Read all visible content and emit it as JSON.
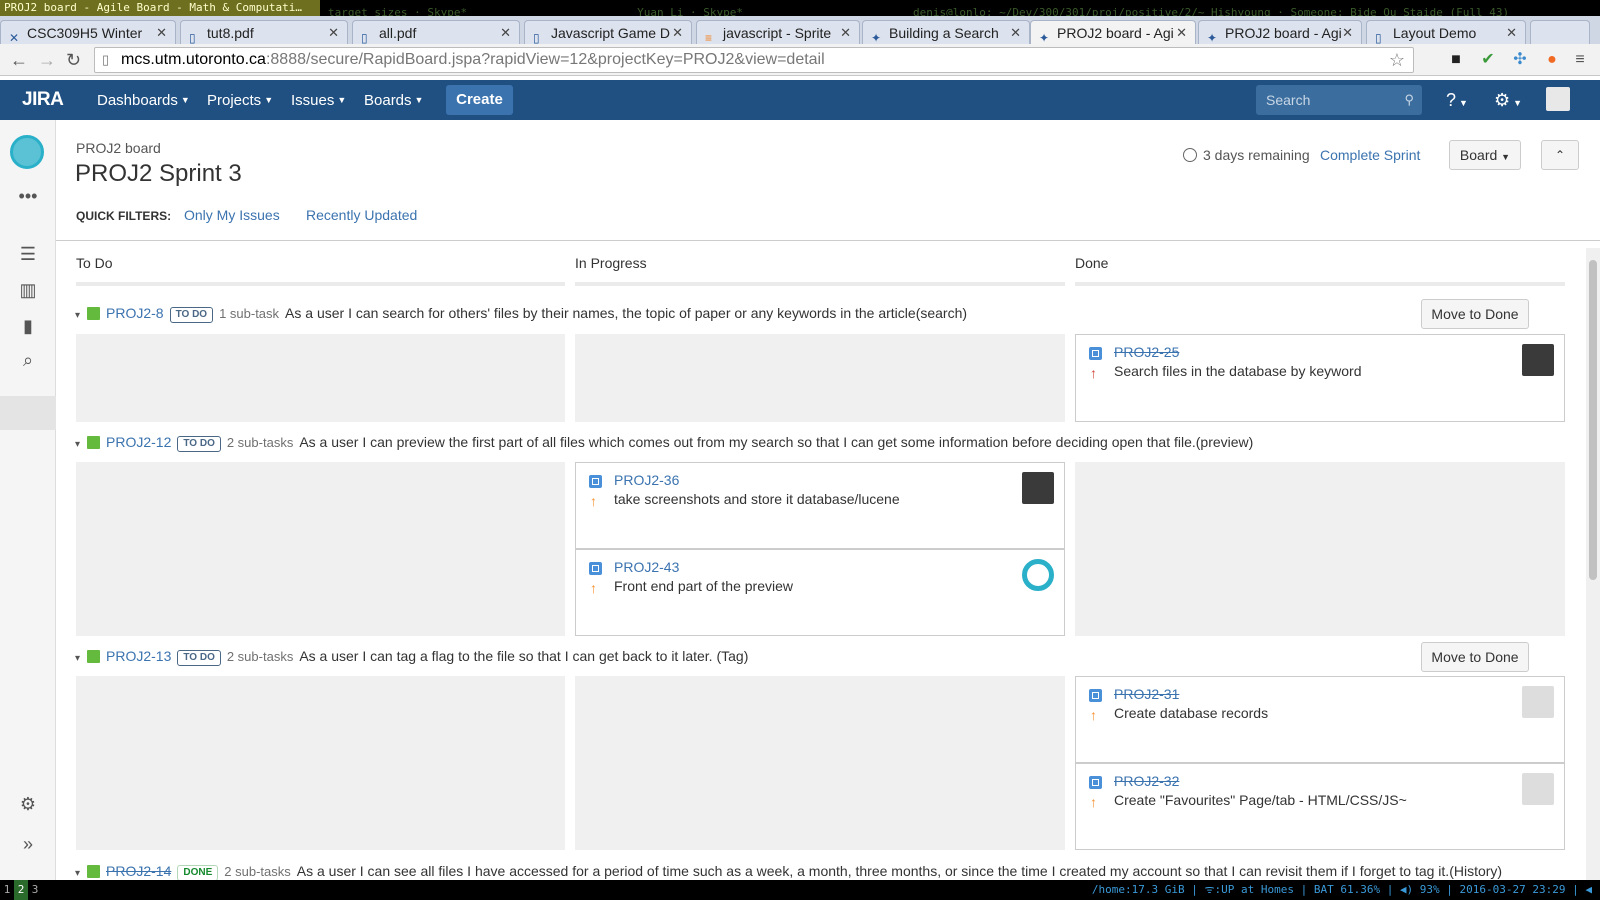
{
  "wm": {
    "active_title": "PROJ2 board - Agile Board - Math & Computati…",
    "dim_1": "target sizes  · Skype*",
    "dim_2": "Yuan Li · Skype*",
    "dim_3": "denis@lonlo: ~/Dev/300/301/proj/positive/2/~ Hishyoung · Someone: Bide Ou Staide (Full 43)"
  },
  "browser_tabs": [
    {
      "label": "CSC309H5 Winter",
      "icon": "jira-icon"
    },
    {
      "label": "tut8.pdf",
      "icon": "document-icon"
    },
    {
      "label": "all.pdf",
      "icon": "document-icon"
    },
    {
      "label": "Javascript Game D",
      "icon": "document-icon"
    },
    {
      "label": "javascript - Sprite",
      "icon": "stackoverflow-icon"
    },
    {
      "label": "Building a Search",
      "icon": "jira-icon"
    },
    {
      "label": "PROJ2 board - Agi",
      "icon": "jira-icon",
      "active": true
    },
    {
      "label": "PROJ2 board - Agi",
      "icon": "jira-icon"
    },
    {
      "label": "Layout Demo",
      "icon": "document-icon"
    }
  ],
  "url": {
    "host": "mcs.utm.utoronto.ca",
    "rest": ":8888/secure/RapidBoard.jspa?rapidView=12&projectKey=PROJ2&view=detail"
  },
  "jira_nav": {
    "logo": "JIRA",
    "dashboards": "Dashboards",
    "projects": "Projects",
    "issues": "Issues",
    "boards": "Boards",
    "create": "Create",
    "search_placeholder": "Search"
  },
  "board": {
    "crumb": "PROJ2 board",
    "title": "PROJ2 Sprint 3",
    "remaining": "3 days remaining",
    "complete_sprint": "Complete Sprint",
    "board_button": "Board",
    "quick_filters_label": "QUICK FILTERS:",
    "quick_filters": [
      "Only My Issues",
      "Recently Updated"
    ],
    "columns": [
      "To Do",
      "In Progress",
      "Done"
    ],
    "move_to_done": "Move to Done"
  },
  "swimlanes": [
    {
      "key": "PROJ2-8",
      "status": "TO DO",
      "subtasks": "1 sub-task",
      "summary": "As a user I can search for others' files by their names, the topic of paper or any keywords in the article(search)",
      "done": false
    },
    {
      "key": "PROJ2-12",
      "status": "TO DO",
      "subtasks": "2 sub-tasks",
      "summary": "As a user I can preview the first part of all files which comes out from my search so that I can get some information before deciding open that file.(preview)",
      "done": false
    },
    {
      "key": "PROJ2-13",
      "status": "TO DO",
      "subtasks": "2 sub-tasks",
      "summary": "As a user I can tag a flag to the file so that I can get back to it later. (Tag)",
      "done": false
    },
    {
      "key": "PROJ2-14",
      "status": "DONE",
      "subtasks": "2 sub-tasks",
      "summary": "As a user I can see all files I have accessed for a period of time such as a week, a month, three months, or since the time I created my account so that I can revisit them if I forget to tag it.(History)",
      "done": true
    }
  ],
  "cards": [
    {
      "key": "PROJ2-25",
      "summary": "Search files in the database by keyword",
      "done": true,
      "priority_color": "#d04437"
    },
    {
      "key": "PROJ2-36",
      "summary": "take screenshots and store it database/lucene",
      "done": false,
      "priority_color": "#f79232"
    },
    {
      "key": "PROJ2-43",
      "summary": "Front end part of the preview",
      "done": false,
      "priority_color": "#f79232"
    },
    {
      "key": "PROJ2-31",
      "summary": "Create database records",
      "done": true,
      "priority_color": "#f79232"
    },
    {
      "key": "PROJ2-32",
      "summary": "Create \"Favourites\" Page/tab - HTML/CSS/JS~",
      "done": true,
      "priority_color": "#f79232"
    }
  ],
  "statusbar": {
    "workspaces": [
      "1",
      "2",
      "3"
    ],
    "right": "/home:17.3 GiB | ᯤ:UP at Homes | BAT 61.36% | ◀) 93% | 2016-03-27 23:29 | ◀"
  },
  "colors": {
    "jira_blue": "#205081",
    "link": "#3b73af",
    "story_green": "#63ba3c"
  }
}
